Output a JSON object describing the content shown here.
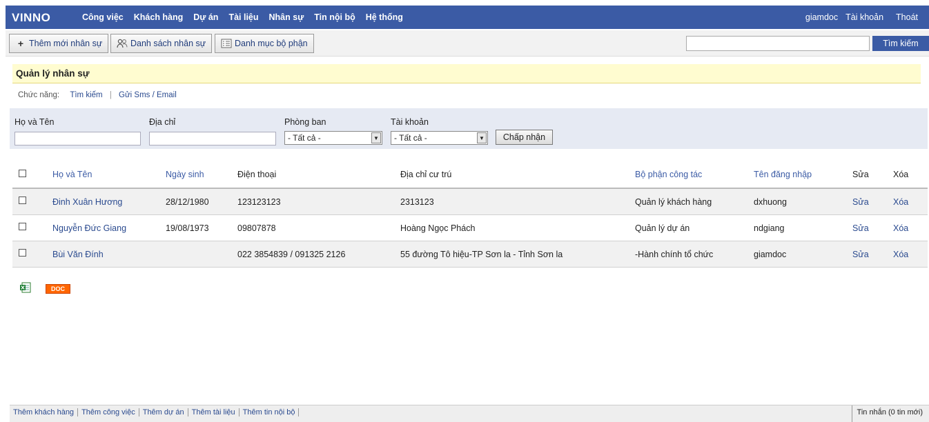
{
  "app": {
    "logo": "VINNO"
  },
  "nav": {
    "items": [
      "Công việc",
      "Khách hàng",
      "Dự án",
      "Tài liệu",
      "Nhân sự",
      "Tin nội bộ",
      "Hệ thống"
    ],
    "user": "giamdoc",
    "account": "Tài khoản",
    "logout": "Thoát"
  },
  "toolbar": {
    "add": "Thêm mới nhân sự",
    "list": "Danh sách nhân sự",
    "dept": "Danh mục bộ phận",
    "search_btn": "Tìm kiếm",
    "search_value": ""
  },
  "page": {
    "title": "Quản lý nhân sự",
    "func_label": "Chức năng:",
    "func_search": "Tìm kiếm",
    "func_sms": "Gửi Sms / Email"
  },
  "filter": {
    "name_label": "Họ và Tên",
    "address_label": "Địa chỉ",
    "dept_label": "Phòng ban",
    "account_label": "Tài khoản",
    "dept_value": "- Tất cả -",
    "account_value": "- Tất cả -",
    "apply": "Chấp nhận"
  },
  "table": {
    "headers": [
      "Họ và Tên",
      "Ngày sinh",
      "Điện thoại",
      "Địa chỉ cư trú",
      "Bộ phận công tác",
      "Tên đăng nhập",
      "Sửa",
      "Xóa"
    ],
    "rows": [
      {
        "name": "Đinh Xuân Hương",
        "dob": "28/12/1980",
        "phone": "123123123",
        "address": "2313123",
        "dept": "Quản lý khách hàng",
        "login": "dxhuong",
        "edit": "Sửa",
        "del": "Xóa"
      },
      {
        "name": "Nguyễn Đức Giang",
        "dob": "19/08/1973",
        "phone": "09807878",
        "address": "Hoàng Ngọc Phách",
        "dept": "Quản lý dự án",
        "login": "ndgiang",
        "edit": "Sửa",
        "del": "Xóa"
      },
      {
        "name": "Bùi Văn Đính",
        "dob": "",
        "phone": "022 3854839 / 091325 2126",
        "address": "55 đường Tô hiệu-TP Sơn la - Tỉnh Sơn la",
        "dept": "-Hành chính tổ chức",
        "login": "giamdoc",
        "edit": "Sửa",
        "del": "Xóa"
      }
    ]
  },
  "export": {
    "doc": "DOC"
  },
  "footer": {
    "links": [
      "Thêm khách hàng",
      "Thêm công việc",
      "Thêm dự án",
      "Thêm tài liệu",
      "Thêm tin nội bộ"
    ],
    "messages": "Tin nhắn (0 tin mới)"
  },
  "colors": {
    "brand": "#3b5ba5",
    "title_bg": "#fffcd0",
    "filter_bg": "#e6eaf3",
    "doc_badge": "#ff6600"
  }
}
